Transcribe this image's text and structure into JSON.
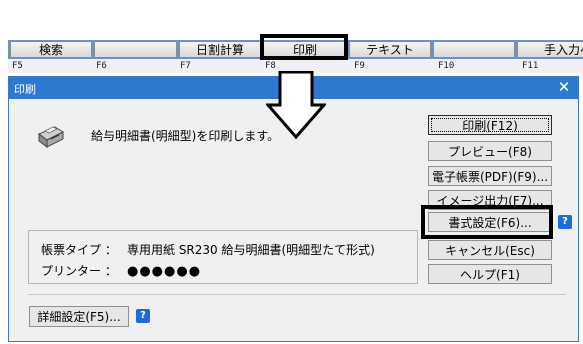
{
  "toolbar": {
    "buttons": [
      {
        "label": "検索"
      },
      {
        "label": ""
      },
      {
        "label": "日割計算"
      },
      {
        "label": "印刷"
      },
      {
        "label": "テキスト"
      },
      {
        "label": ""
      },
      {
        "label": "手入力へ"
      }
    ],
    "fkeys": [
      "F5",
      "F6",
      "F7",
      "F8",
      "F9",
      "F10",
      "F11"
    ]
  },
  "dialog": {
    "title": "印刷",
    "close_icon": "close-icon",
    "message": "給与明細書(明細型)を印刷します。",
    "form_type_label": "帳票タイプ ：",
    "form_type_value": "専用用紙 SR230  給与明細書(明細型たて形式)",
    "printer_label": "プリンター ：",
    "printer_value": "●●●●●●",
    "buttons": {
      "print": "印刷(F12)",
      "preview": "プレビュー(F8)",
      "pdf": "電子帳票(PDF)(F9)...",
      "image": "イメージ出力(F7)...",
      "format": "書式設定(F6)...",
      "cancel": "キャンセル(Esc)",
      "help": "ヘルプ(F1)",
      "detail": "詳細設定(F5)..."
    },
    "help_icon_text": "?"
  }
}
